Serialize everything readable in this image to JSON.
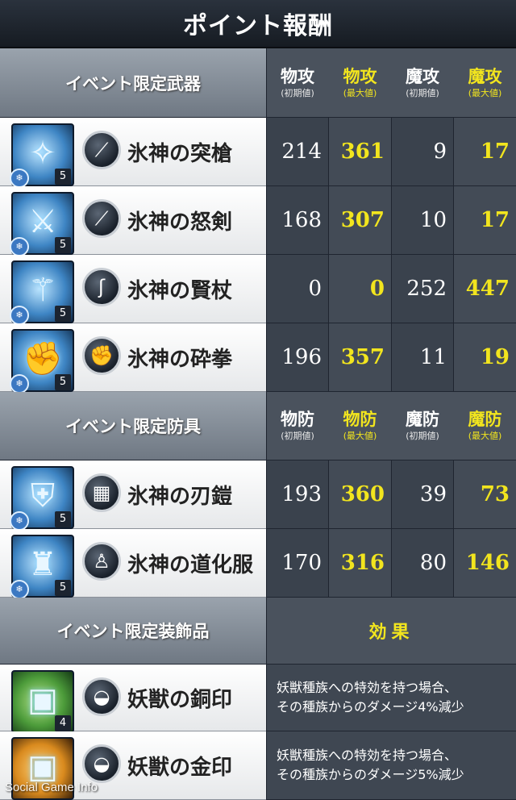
{
  "title": "ポイント報酬",
  "weapons_section": {
    "label": "イベント限定武器",
    "columns": [
      {
        "main": "物攻",
        "sub": "(初期値)",
        "type": "init"
      },
      {
        "main": "物攻",
        "sub": "(最大値)",
        "type": "max"
      },
      {
        "main": "魔攻",
        "sub": "(初期値)",
        "type": "init"
      },
      {
        "main": "魔攻",
        "sub": "(最大値)",
        "type": "max"
      }
    ],
    "items": [
      {
        "name": "氷神の突槍",
        "type_icon": "spear-icon",
        "level": "5",
        "values": [
          "214",
          "361",
          "9",
          "17"
        ]
      },
      {
        "name": "氷神の怒剣",
        "type_icon": "sword-icon",
        "level": "5",
        "values": [
          "168",
          "307",
          "10",
          "17"
        ]
      },
      {
        "name": "氷神の賢杖",
        "type_icon": "staff-icon",
        "level": "5",
        "values": [
          "0",
          "0",
          "252",
          "447"
        ]
      },
      {
        "name": "氷神の砕拳",
        "type_icon": "fist-icon",
        "level": "5",
        "values": [
          "196",
          "357",
          "11",
          "19"
        ]
      }
    ]
  },
  "armor_section": {
    "label": "イベント限定防具",
    "columns": [
      {
        "main": "物防",
        "sub": "(初期値)",
        "type": "init"
      },
      {
        "main": "物防",
        "sub": "(最大値)",
        "type": "max"
      },
      {
        "main": "魔防",
        "sub": "(初期値)",
        "type": "init"
      },
      {
        "main": "魔防",
        "sub": "(最大値)",
        "type": "max"
      }
    ],
    "items": [
      {
        "name": "氷神の刃鎧",
        "type_icon": "armor-icon",
        "level": "5",
        "values": [
          "193",
          "360",
          "39",
          "73"
        ]
      },
      {
        "name": "氷神の道化服",
        "type_icon": "robe-icon",
        "level": "5",
        "values": [
          "170",
          "316",
          "80",
          "146"
        ]
      }
    ]
  },
  "accessory_section": {
    "label": "イベント限定装飾品",
    "effect_header": "効果",
    "items": [
      {
        "name": "妖獣の銅印",
        "type_icon": "accessory-icon",
        "level": "4",
        "effect_line1": "妖獣種族への特効を持つ場合、",
        "effect_line2": "その種族からのダメージ4%減少"
      },
      {
        "name": "妖獣の金印",
        "type_icon": "accessory-icon",
        "level": "",
        "effect_line1": "妖獣種族への特効を持つ場合、",
        "effect_line2": "その種族からのダメージ5%減少"
      }
    ]
  },
  "watermark": "Social Game Info",
  "colors": {
    "max_value": "#f2e51e",
    "init_value": "#ffffff",
    "header_bg": "#6f7883"
  }
}
